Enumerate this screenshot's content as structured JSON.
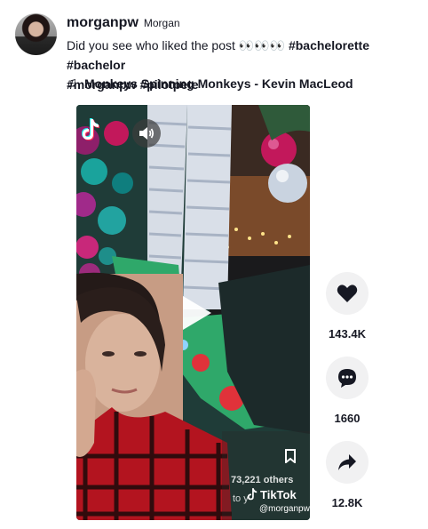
{
  "author": {
    "username": "morganpw",
    "nickname": "Morgan"
  },
  "caption": {
    "text": "Did you see who liked the post 👀👀👀",
    "hashtags": [
      "#bachelorette",
      "#bachelor",
      "#morganpw",
      "#pilotpete"
    ]
  },
  "music": {
    "title": "Monkeys Spinning Monkeys - Kevin MacLeod",
    "icon": "music-note-icon"
  },
  "video": {
    "overlay_count_text": "73,221 others",
    "overlay_partial_text": "to y",
    "watermark_brand": "TikTok",
    "watermark_handle": "@morganpw",
    "icons": [
      "tiktok-logo-icon",
      "sound-icon",
      "play-icon",
      "bookmark-icon"
    ]
  },
  "actions": {
    "likes": "143.4K",
    "comments": "1660",
    "shares": "12.8K"
  },
  "colors": {
    "text": "#161823",
    "action_bg": "#f1f1f2",
    "sock_green": "#2fa86a",
    "plaid_red": "#b3141f",
    "ornament_pink": "#c2185b"
  }
}
